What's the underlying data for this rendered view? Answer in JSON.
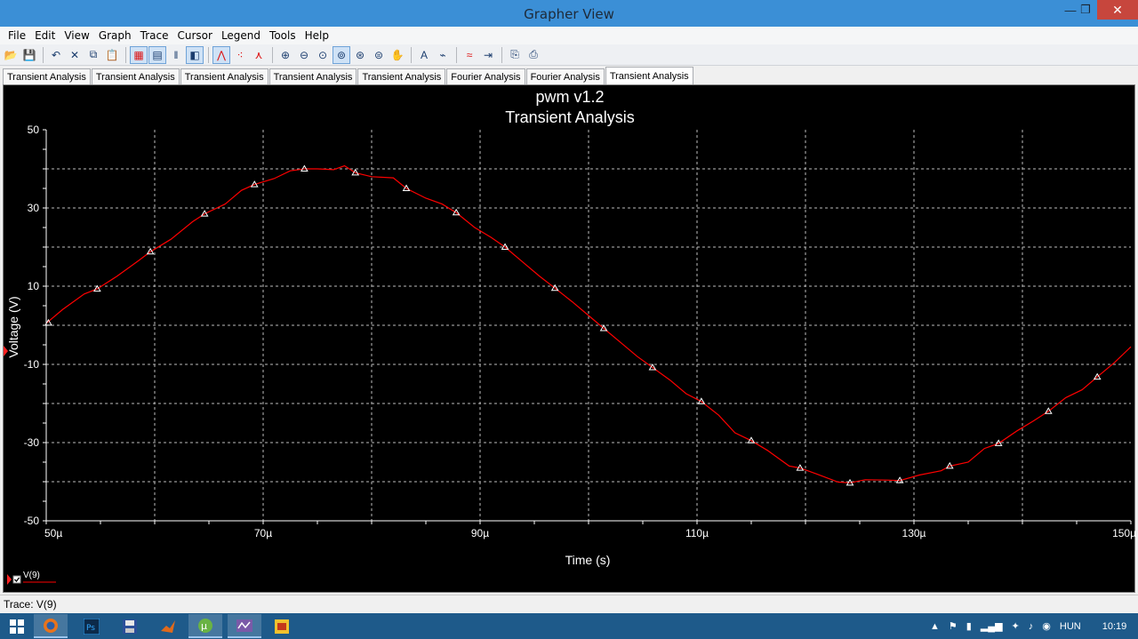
{
  "window": {
    "title": "Grapher View"
  },
  "menu": [
    "File",
    "Edit",
    "View",
    "Graph",
    "Trace",
    "Cursor",
    "Legend",
    "Tools",
    "Help"
  ],
  "toolbar": {
    "groups": [
      [
        "open-icon",
        "save-icon"
      ],
      [
        "undo-icon",
        "delete-icon",
        "copy-icon",
        "paste-icon"
      ],
      [
        "grid-icon",
        "legend-icon",
        "cursor-bars-icon",
        "overlay-icon"
      ],
      [
        "line-trace-icon",
        "dot-trace-icon",
        "marker-trace-icon"
      ],
      [
        "zoom-in-icon",
        "zoom-out-icon",
        "zoom-area-icon",
        "zoom-full-icon",
        "zoom-x-icon",
        "zoom-y-icon",
        "pan-hand-icon"
      ],
      [
        "text-icon",
        "label-icon"
      ],
      [
        "trace-props-icon",
        "export-icon"
      ],
      [
        "copy-graph-icon",
        "print-icon"
      ]
    ],
    "active": [
      "grid-icon",
      "legend-icon",
      "overlay-icon",
      "line-trace-icon",
      "zoom-full-icon"
    ]
  },
  "tabs": [
    "Transient Analysis",
    "Transient Analysis",
    "Transient Analysis",
    "Transient Analysis",
    "Transient Analysis",
    "Fourier Analysis",
    "Fourier Analysis",
    "Transient Analysis"
  ],
  "active_tab": 7,
  "graph": {
    "line1": "pwm v1.2",
    "line2": "Transient Analysis",
    "legend_label": "V(9)"
  },
  "chart_data": {
    "type": "line",
    "title": "pwm v1.2",
    "subtitle": "Transient Analysis",
    "xlabel": "Time (s)",
    "ylabel": "Voltage (V)",
    "xlim": [
      50,
      150
    ],
    "ylim": [
      -50,
      50
    ],
    "x_unit": "µ",
    "x_ticks": [
      50,
      70,
      90,
      110,
      130,
      150
    ],
    "x_tick_labels": [
      "50µ",
      "70µ",
      "90µ",
      "110µ",
      "130µ",
      "150µ"
    ],
    "y_ticks": [
      50,
      30,
      10,
      -10,
      -30,
      -50
    ],
    "y_tick_labels": [
      "50",
      "30",
      "10",
      "-10",
      "-30",
      "-50"
    ],
    "grid": true,
    "legend": "bottom-left",
    "series": [
      {
        "name": "V(9)",
        "color": "#ff0000",
        "marker": "triangle",
        "x": [
          50,
          51.5,
          53.5,
          54.7,
          56.5,
          58.5,
          59.6,
          61.5,
          63.5,
          64.6,
          66.5,
          68,
          69.2,
          71,
          72.5,
          73.8,
          75,
          76.5,
          77.5,
          78.5,
          80,
          82,
          83.2,
          85,
          86.5,
          87.8,
          89.5,
          91,
          92.3,
          94,
          95.5,
          96.9,
          98.5,
          100,
          101.4,
          103,
          104.5,
          105.9,
          107.5,
          109,
          110.4,
          112,
          113.5,
          115,
          116.5,
          118.5,
          119.5,
          121,
          123,
          124.1,
          125.5,
          127.5,
          128.7,
          130.5,
          132.5,
          133.3,
          135,
          136.5,
          137.8,
          139.5,
          141,
          142.4,
          144,
          145.5,
          146.9,
          148.5,
          150
        ],
        "y": [
          0.5,
          4,
          8,
          9.3,
          12.5,
          16.5,
          18.8,
          22,
          26.5,
          28.5,
          31,
          34.5,
          36,
          37.5,
          39.5,
          40,
          40,
          39.8,
          40.8,
          39,
          38,
          37.7,
          35,
          32.5,
          31,
          28.8,
          25,
          22.5,
          20,
          16,
          12.5,
          9.5,
          6,
          2.5,
          -0.8,
          -4.5,
          -8,
          -10.8,
          -14,
          -17.5,
          -19.5,
          -23,
          -27.5,
          -29.5,
          -32,
          -36,
          -36.5,
          -38,
          -40.1,
          -40.3,
          -39.5,
          -39.6,
          -39.7,
          -38.3,
          -37.2,
          -36,
          -35,
          -31.5,
          -30.2,
          -27,
          -24.5,
          -22,
          -18.5,
          -16.5,
          -13.2,
          -9.5,
          -5.5
        ],
        "markers_x": [
          50.2,
          54.7,
          59.6,
          64.6,
          69.2,
          73.8,
          78.5,
          83.2,
          87.8,
          92.3,
          96.9,
          101.4,
          105.9,
          110.4,
          115,
          119.5,
          124.1,
          128.7,
          133.3,
          137.8,
          142.4,
          146.9
        ],
        "markers_y": [
          0.6,
          9.3,
          18.8,
          28.5,
          36,
          40,
          39,
          35,
          28.8,
          20,
          9.5,
          -0.8,
          -10.8,
          -19.5,
          -29.5,
          -36.5,
          -40.3,
          -39.7,
          -36,
          -30.2,
          -22,
          -13.2
        ]
      }
    ]
  },
  "status": {
    "text": "Trace: V(9)"
  },
  "taskbar": {
    "apps": [
      {
        "icon": "windows-start-icon",
        "open": false
      },
      {
        "icon": "firefox-icon",
        "open": true
      },
      {
        "icon": "photoshop-icon",
        "open": false
      },
      {
        "icon": "save-disk-icon",
        "open": false
      },
      {
        "icon": "matlab-icon",
        "open": false
      },
      {
        "icon": "utorrent-icon",
        "open": true
      },
      {
        "icon": "multisim-icon",
        "open": true
      },
      {
        "icon": "pdf-icon",
        "open": false
      }
    ],
    "language": "HUN",
    "time": "10:19"
  }
}
